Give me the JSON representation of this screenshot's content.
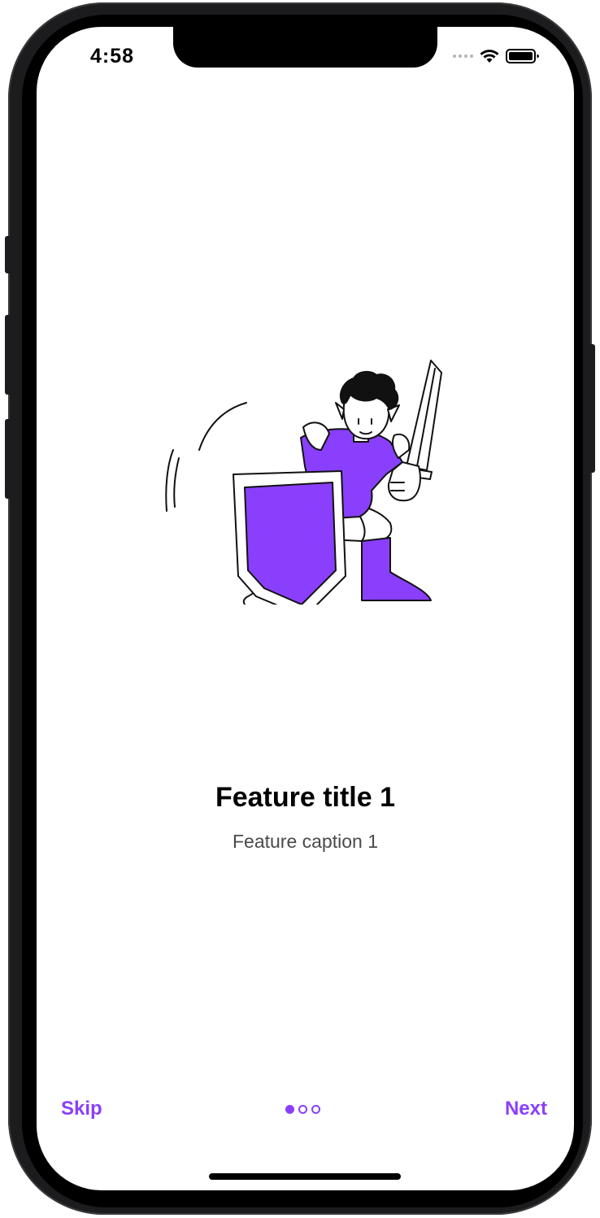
{
  "status_bar": {
    "time": "4:58"
  },
  "onboarding": {
    "illustration_icon": "knight-with-shield-and-sword-illustration",
    "title": "Feature title 1",
    "caption": "Feature caption 1"
  },
  "footer": {
    "skip_label": "Skip",
    "next_label": "Next",
    "page_count": 3,
    "current_page": 1
  },
  "colors": {
    "accent": "#8a3ffc",
    "title": "#000000",
    "caption": "#4a4a4a"
  }
}
